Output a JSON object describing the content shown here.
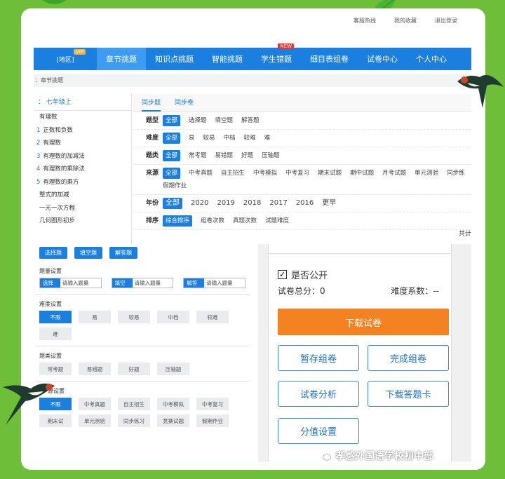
{
  "top_links": [
    "客服热线",
    "我的收藏",
    "退出登录"
  ],
  "nav": {
    "region": "[地区]",
    "vip": "VIP",
    "items": [
      {
        "label": "章节挑题",
        "active": true
      },
      {
        "label": "知识点挑题"
      },
      {
        "label": "智能挑题"
      },
      {
        "label": "学生错题",
        "badge": "NEW"
      },
      {
        "label": "细目表组卷"
      },
      {
        "label": "试卷中心"
      },
      {
        "label": "个人中心"
      }
    ]
  },
  "breadcrumb": "：章节挑题",
  "sidebar": {
    "header": "：  七年级上",
    "chapters": [
      {
        "n": "",
        "t": "有理数"
      },
      {
        "n": "1",
        "t": "正数和负数"
      },
      {
        "n": "2",
        "t": "有理数"
      },
      {
        "n": "3",
        "t": "有理数的加减法"
      },
      {
        "n": "4",
        "t": "有理数的乘除法"
      },
      {
        "n": "5",
        "t": "有理数的乘方"
      },
      {
        "n": "",
        "t": "整式的加减"
      },
      {
        "n": "",
        "t": "一元一次方程"
      },
      {
        "n": "",
        "t": "几何图形初步"
      }
    ]
  },
  "tabs": [
    "同步题",
    "同步卷"
  ],
  "filters": [
    {
      "label": "题型",
      "options": [
        "全部",
        "选择题",
        "填空题",
        "解答题"
      ]
    },
    {
      "label": "难度",
      "options": [
        "全部",
        "易",
        "较易",
        "中档",
        "较难",
        "难"
      ]
    },
    {
      "label": "题类",
      "options": [
        "全部",
        "常考题",
        "易错题",
        "好题",
        "压轴题"
      ]
    },
    {
      "label": "来源",
      "options": [
        "全部",
        "中考真题",
        "自主招生",
        "中考模拟",
        "中考复习",
        "期末试题",
        "期中试题",
        "月考试题",
        "单元测验",
        "同步练",
        "假期作业"
      ]
    },
    {
      "label": "年份",
      "options": [
        "全部",
        "2020",
        "2019",
        "2018",
        "2017",
        "2016",
        "更早"
      ]
    },
    {
      "label": "排序",
      "options": [
        "综合排序",
        "组卷次数",
        "真题次数",
        "试题难度"
      ]
    }
  ],
  "result_total": "共计",
  "paper_settings": {
    "type_buttons": [
      "选择题",
      "填空题",
      "解答题"
    ],
    "count_title": "题量设置",
    "count_inputs": [
      {
        "type": "选择题",
        "placeholder": "请输入题量"
      },
      {
        "type": "填空题",
        "placeholder": "请输入题量"
      },
      {
        "type": "解答题",
        "placeholder": "请输入题量"
      }
    ],
    "difficulty_title": "难度设置",
    "difficulty": [
      "不限",
      "易",
      "较易",
      "中档",
      "较难",
      "难"
    ],
    "category_title": "题类设置",
    "category": [
      "常考题",
      "易错题",
      "好题",
      "压轴题"
    ],
    "source_title": "源设置",
    "source": [
      "不限",
      "中考真题",
      "自主招生",
      "中考模拟",
      "中考复习",
      "期末试",
      "单元测验",
      "同步练习",
      "竞赛试题",
      "假期作业"
    ]
  },
  "right_panel": {
    "public_label": "是否公开",
    "public_checked": "✓",
    "total_score": "试卷总分：0",
    "difficulty_coef": "难度系数：--",
    "download_button": "下载试卷",
    "buttons": [
      "暂存组卷",
      "完成组卷",
      "试卷分析",
      "下载答题卡",
      "分值设置"
    ]
  },
  "watermark": "孝感外国语学校初中部",
  "colors": {
    "background": "#6fbe3a",
    "primary": "#1b7fe0",
    "orange": "#f58220",
    "new_badge": "#e8362d"
  }
}
